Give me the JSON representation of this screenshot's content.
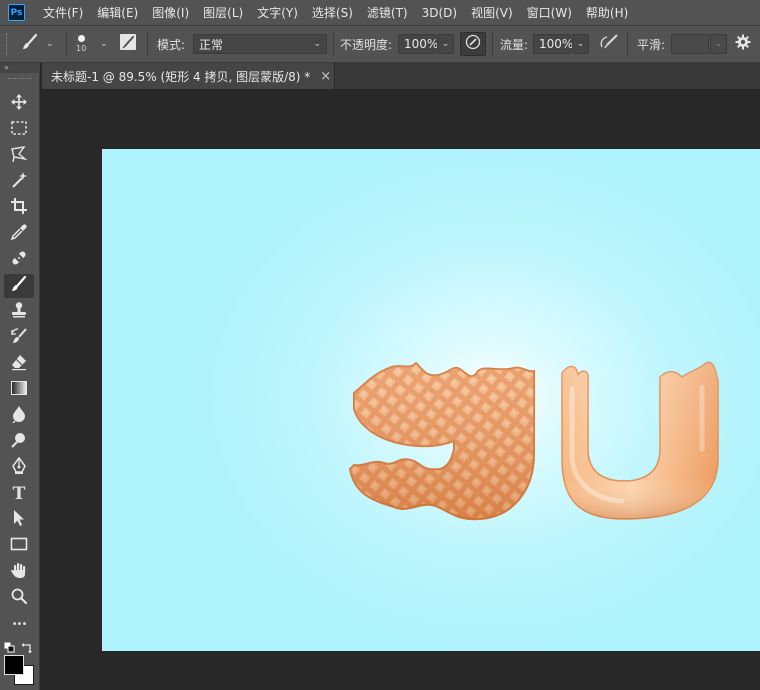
{
  "app": {
    "logo": "Ps"
  },
  "menu": [
    "文件(F)",
    "编辑(E)",
    "图像(I)",
    "图层(L)",
    "文字(Y)",
    "选择(S)",
    "滤镜(T)",
    "3D(D)",
    "视图(V)",
    "窗口(W)",
    "帮助(H)"
  ],
  "options": {
    "brush_size": "10",
    "mode_label": "模式:",
    "mode_value": "正常",
    "opacity_label": "不透明度:",
    "opacity_value": "100%",
    "flow_label": "流量:",
    "flow_value": "100%",
    "smoothing_label": "平滑:",
    "smoothing_value": ""
  },
  "document": {
    "tab_title": "未标题-1 @ 89.5% (矩形 4 拷贝, 图层蒙版/8) *",
    "close_glyph": "×"
  },
  "toolbar": {
    "collapse_glyph": "»",
    "tools": [
      "move-tool",
      "marquee-tool",
      "lasso-tool",
      "magic-wand-tool",
      "crop-tool",
      "eyedropper-tool",
      "healing-brush-tool",
      "brush-tool",
      "clone-stamp-tool",
      "history-brush-tool",
      "eraser-tool",
      "gradient-tool",
      "blur-tool",
      "dodge-tool",
      "pen-tool",
      "type-tool",
      "path-selection-tool",
      "rectangle-tool",
      "hand-tool",
      "zoom-tool",
      "more-tools"
    ],
    "active_tool": "brush-tool",
    "type_tool_glyph": "T",
    "more_glyph": "•••"
  },
  "colors": {
    "foreground": "#000000",
    "background": "#ffffff",
    "canvas_center": "#ffffff",
    "canvas_edge": "#aef2fb",
    "waffle": "#e8935a",
    "cream": "#f7c497"
  }
}
